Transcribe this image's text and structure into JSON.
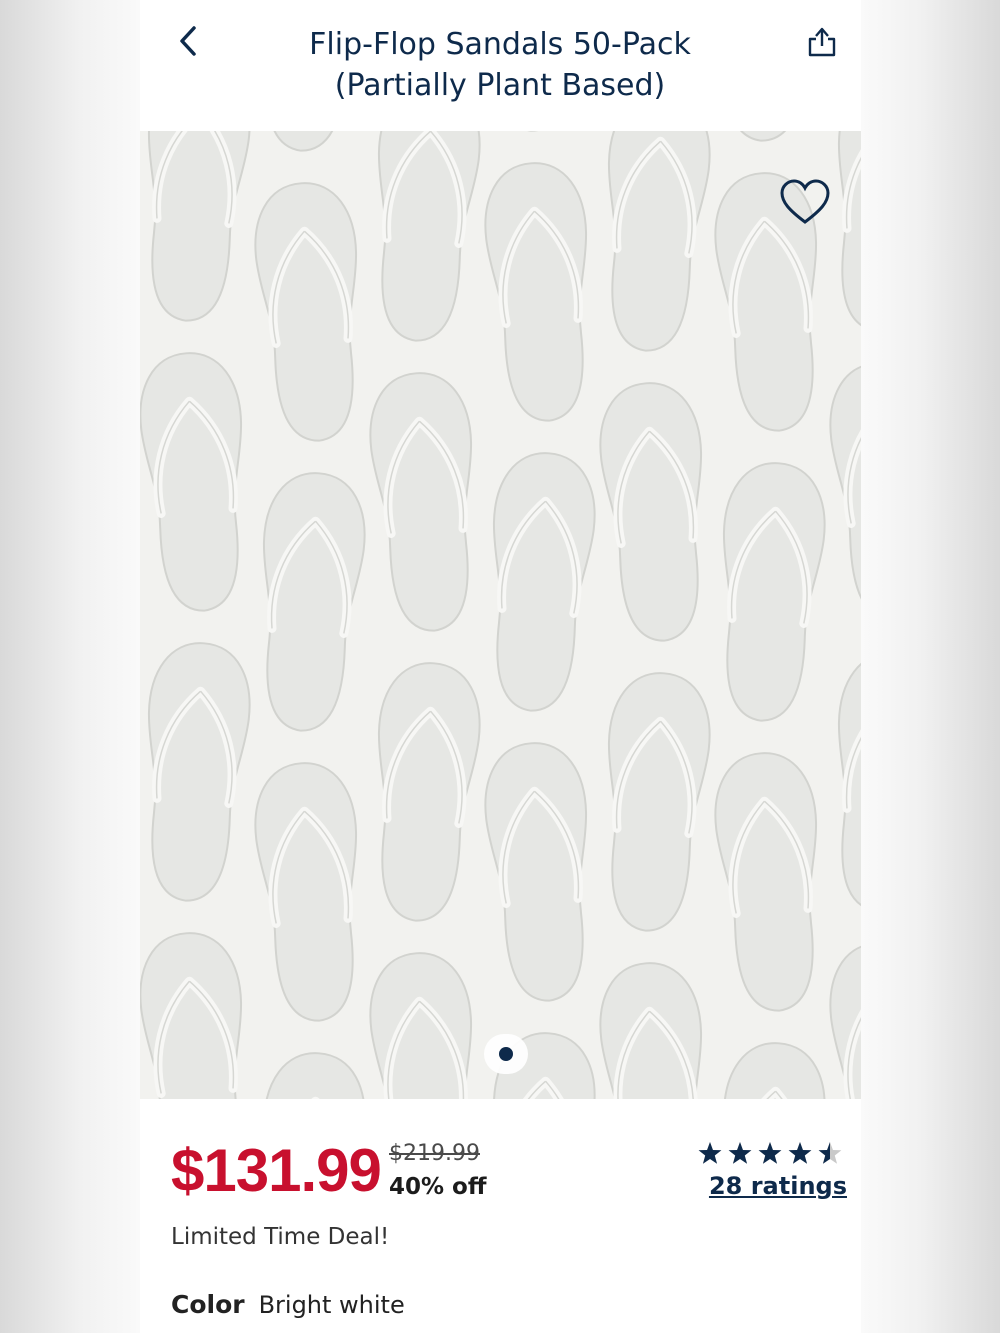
{
  "header": {
    "title_line1": "Flip-Flop Sandals 50-Pack",
    "title_line2": "(Partially Plant Based)"
  },
  "icons": {
    "back": "chevron-left-icon",
    "share": "share-icon",
    "favorite": "heart-outline-icon"
  },
  "carousel": {
    "current": 1,
    "total": 1
  },
  "pricing": {
    "sale_price": "$131.99",
    "original_price": "$219.99",
    "discount": "40% off",
    "deal_text": "Limited Time Deal!",
    "sale_color": "#c8102e"
  },
  "rating": {
    "stars": 4.5,
    "max": 5,
    "count_label": "28 ratings"
  },
  "color": {
    "label": "Color",
    "value": "Bright white"
  },
  "brand_color": "#0e2a4b"
}
